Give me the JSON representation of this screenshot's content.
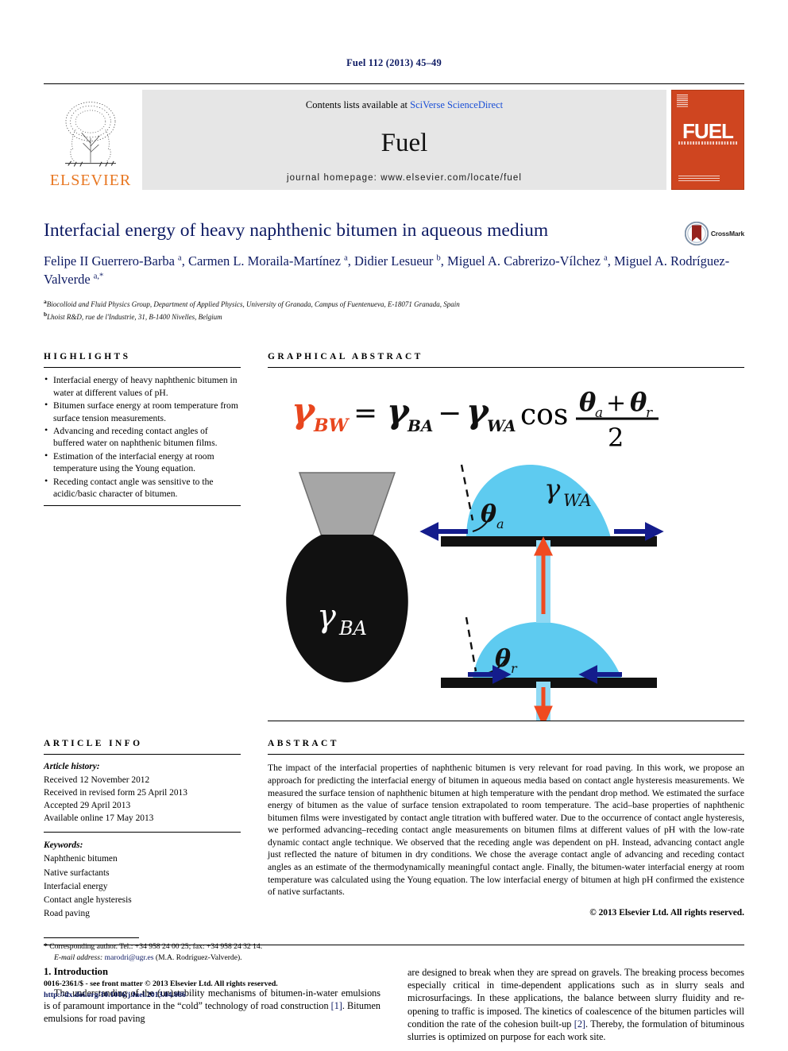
{
  "running_head": "Fuel 112 (2013) 45–49",
  "masthead": {
    "contents_prefix": "Contents lists available at ",
    "sciencedirect": "SciVerse ScienceDirect",
    "journal_name": "Fuel",
    "homepage": "journal homepage: www.elsevier.com/locate/fuel",
    "publisher": "ELSEVIER",
    "cover_title": "FUEL",
    "colors": {
      "elsevier_orange": "#e87722",
      "cover_orange": "#cf4520",
      "link_blue": "#1a4fd6"
    }
  },
  "article": {
    "title": "Interfacial energy of heavy naphthenic bitumen in aqueous medium",
    "crossmark_label": "CrossMark",
    "authors_html": "Felipe II Guerrero-Barba <sup>a</sup>, Carmen L. Moraila-Martínez <sup>a</sup>, Didier Lesueur <sup>b</sup>, Miguel A. Cabrerizo-Vílchez <sup>a</sup>, Miguel A. Rodríguez-Valverde <sup>a,*</sup>",
    "affiliations": [
      "a Biocolloid and Fluid Physics Group, Department of Applied Physics, University of Granada, Campus of Fuentenueva, E-18071 Granada, Spain",
      "b Lhoist R&D, rue de l'Industrie, 31, B-1400 Nivelles, Belgium"
    ]
  },
  "highlights": {
    "heading": "HIGHLIGHTS",
    "items": [
      "Interfacial energy of heavy naphthenic bitumen in water at different values of pH.",
      "Bitumen surface energy at room temperature from surface tension measurements.",
      "Advancing and receding contact angles of buffered water on naphthenic bitumen films.",
      "Estimation of the interfacial energy at room temperature using the Young equation.",
      "Receding contact angle was sensitive to the acidic/basic character of bitumen."
    ]
  },
  "graphical_abstract": {
    "heading": "GRAPHICAL ABSTRACT",
    "equation": {
      "lhs": "γ_BW",
      "full": "γ_BW = γ_BA − γ_WA cos((θ_a + θ_r)/2)",
      "terms": {
        "gamma_bw": "BW",
        "gamma_ba": "BA",
        "gamma_wa": "WA",
        "theta_a": "a",
        "theta_r": "r",
        "denominator": "2"
      }
    },
    "labels": {
      "pendant_drop": "BA",
      "sessile_drop": "WA",
      "advancing_angle": "a",
      "receding_angle": "r"
    },
    "colors": {
      "gamma_bw_highlight": "#e8461e",
      "water": "#5ecbf0",
      "substrate": "#111111",
      "needle": "#9e9e9e",
      "arrow_blue": "#141c8c",
      "arrow_red": "#ef4a20"
    }
  },
  "article_info": {
    "heading": "ARTICLE INFO",
    "history_label": "Article history:",
    "history": [
      "Received 12 November 2012",
      "Received in revised form 25 April 2013",
      "Accepted 29 April 2013",
      "Available online 17 May 2013"
    ],
    "keywords_label": "Keywords:",
    "keywords": [
      "Naphthenic bitumen",
      "Native surfactants",
      "Interfacial energy",
      "Contact angle hysteresis",
      "Road paving"
    ]
  },
  "abstract": {
    "heading": "ABSTRACT",
    "text": "The impact of the interfacial properties of naphthenic bitumen is very relevant for road paving. In this work, we propose an approach for predicting the interfacial energy of bitumen in aqueous media based on contact angle hysteresis measurements. We measured the surface tension of naphthenic bitumen at high temperature with the pendant drop method. We estimated the surface energy of bitumen as the value of surface tension extrapolated to room temperature. The acid–base properties of naphthenic bitumen films were investigated by contact angle titration with buffered water. Due to the occurrence of contact angle hysteresis, we performed advancing–receding contact angle measurements on bitumen films at different values of pH with the low-rate dynamic contact angle technique. We observed that the receding angle was dependent on pH. Instead, advancing contact angle just reflected the nature of bitumen in dry conditions. We chose the average contact angle of advancing and receding contact angles as an estimate of the thermodynamically meaningful contact angle. Finally, the bitumen-water interfacial energy at room temperature was calculated using the Young equation. The low interfacial energy of bitumen at high pH confirmed the existence of native surfactants.",
    "copyright": "© 2013 Elsevier Ltd. All rights reserved."
  },
  "body": {
    "section_number_title": "1. Introduction",
    "left_paragraph_html": "The understanding of the (un)stability mechanisms of bitumen-in-water emulsions is of paramount importance in the “cold” technology of road construction <span class=\"ref\">[1]</span>. Bitumen emulsions for road paving",
    "right_paragraph_html": "are designed to break when they are spread on gravels. The breaking process becomes especially critical in time-dependent applications such as in slurry seals and microsurfacings. In these applications, the balance between slurry fluidity and re-opening to traffic is imposed. The kinetics of coalescence of the bitumen particles will condition the rate of the cohesion built-up <span class=\"ref\">[2]</span>. Thereby, the formulation of bituminous slurries is optimized on purpose for each work site."
  },
  "footnote": {
    "star": "*",
    "corresponding": "Corresponding author. Tel.: +34 958 24 00 25; fax: +34 958 24 32 14.",
    "email_label": "E-mail address:",
    "email": "marodri@ugr.es",
    "email_owner": "(M.A. Rodríguez-Valverde)."
  },
  "colophon": {
    "issn_line": "0016-2361/$ - see front matter © 2013 Elsevier Ltd. All rights reserved.",
    "doi": "http://dx.doi.org/10.1016/j.fuel.2013.04.086"
  }
}
